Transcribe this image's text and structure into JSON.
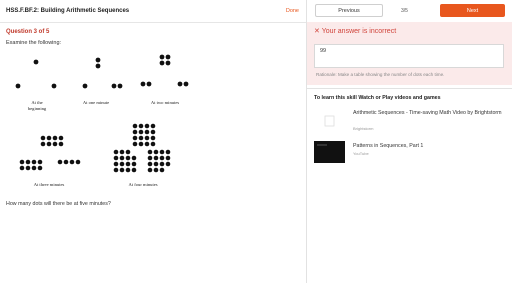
{
  "header": {
    "title": "HSS.F.BF.2: Building Arithmetic Sequences",
    "done_label": "Done"
  },
  "question": {
    "number_label": "Question 3 of 5",
    "prompt": "Examine the following:",
    "figures": [
      {
        "caption_line1": "At the",
        "caption_line2": "beginning",
        "dots": 3
      },
      {
        "caption_line1": "At one minute",
        "caption_line2": "",
        "dots": 5
      },
      {
        "caption_line1": "At two minutes",
        "caption_line2": "",
        "dots": 8
      },
      {
        "caption_line1": "At three minutes",
        "caption_line2": "",
        "dots": 20
      },
      {
        "caption_line1": "At four minutes",
        "caption_line2": "",
        "dots": 45
      }
    ],
    "text": "How many dots will there be at five minutes?"
  },
  "nav": {
    "previous_label": "Previous",
    "counter": "3/5",
    "next_label": "Next"
  },
  "feedback": {
    "icon": "close-x-icon",
    "message": "Your answer is incorrect",
    "answer_value": "99",
    "rationale": "Rationale: Make a table showing the number of dots each time."
  },
  "learning": {
    "heading": "To learn this skill Watch or Play videos and games",
    "resources": [
      {
        "title": "Arithmetic Sequences - Time-saving Math Video by Brightstorm",
        "source": "Brightstorm",
        "thumb": "placeholder"
      },
      {
        "title": "Patterns in Sequences, Part 1",
        "source": "YouTube",
        "thumb": "video"
      }
    ]
  },
  "colors": {
    "accent": "#e8571e",
    "error": "#d0433a",
    "error_bg": "#fbeaea"
  }
}
